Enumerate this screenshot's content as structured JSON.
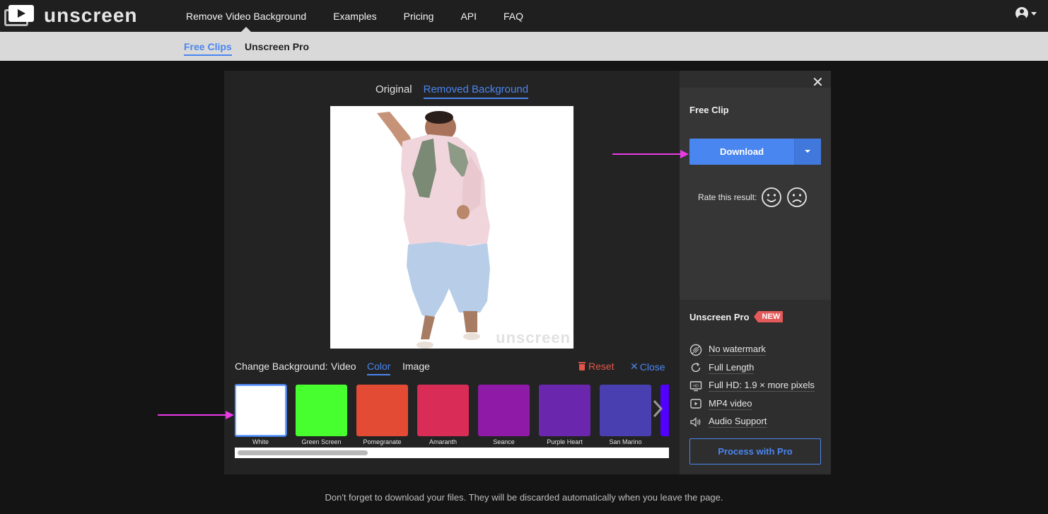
{
  "brand": {
    "name": "unscreen"
  },
  "nav": {
    "items": [
      "Remove Video Background",
      "Examples",
      "Pricing",
      "API",
      "FAQ"
    ]
  },
  "subnav": {
    "free": "Free Clips",
    "pro": "Unscreen Pro"
  },
  "editor": {
    "view_tabs": [
      "Original",
      "Removed Background"
    ],
    "watermark": "unscreen",
    "change_bg_label": "Change Background:",
    "bg_tabs": [
      "Video",
      "Color",
      "Image"
    ],
    "reset": "Reset",
    "close": "Close",
    "swatches": [
      {
        "name": "White",
        "color": "#ffffff"
      },
      {
        "name": "Green Screen",
        "color": "#47ff2e"
      },
      {
        "name": "Pomegranate",
        "color": "#e34b35"
      },
      {
        "name": "Amaranth",
        "color": "#d92d57"
      },
      {
        "name": "Seance",
        "color": "#901aa8"
      },
      {
        "name": "Purple Heart",
        "color": "#6a26ad"
      },
      {
        "name": "San Marino",
        "color": "#4a3fb0"
      },
      {
        "name": "",
        "color": "#5200ff"
      }
    ]
  },
  "side": {
    "free_clip": "Free Clip",
    "download": "Download",
    "rate": "Rate this result:",
    "pro_title": "Unscreen Pro",
    "new_badge": "NEW",
    "features": [
      {
        "icon": "no-watermark-icon",
        "text": "No watermark"
      },
      {
        "icon": "full-length-icon",
        "text": "Full Length"
      },
      {
        "icon": "hd-icon",
        "text": "Full HD: 1.9 × more pixels"
      },
      {
        "icon": "mp4-icon",
        "text": "MP4 video"
      },
      {
        "icon": "audio-icon",
        "text": "Audio Support"
      }
    ],
    "process_pro": "Process with Pro"
  },
  "footer": "Don't forget to download your files. They will be discarded automatically when you leave the page.",
  "colors": {
    "accent": "#4a86f0",
    "danger": "#e0574a",
    "annotation": "#e83ce6"
  }
}
